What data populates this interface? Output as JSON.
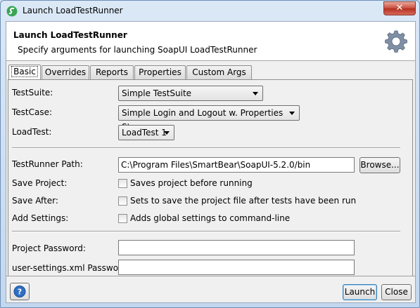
{
  "window": {
    "title": "Launch LoadTestRunner",
    "close_label": "✕"
  },
  "header": {
    "title": "Launch LoadTestRunner",
    "subtitle": "Specify arguments for launching SoapUI LoadTestRunner",
    "icon": "gear-icon"
  },
  "tabs": [
    "Basic",
    "Overrides",
    "Reports",
    "Properties",
    "Custom Args"
  ],
  "basic": {
    "testsuite_label": "TestSuite:",
    "testsuite_value": "Simple TestSuite",
    "testcase_label": "TestCase:",
    "testcase_value": "Simple Login and Logout w. Properties Steps",
    "loadtest_label": "LoadTest:",
    "loadtest_value": "LoadTest 1",
    "runner_path_label": "TestRunner Path:",
    "runner_path_value": "C:\\Program Files\\SmartBear\\SoapUI-5.2.0/bin",
    "browse_label": "Browse...",
    "save_project_label": "Save Project:",
    "save_project_text": "Saves project before running",
    "save_after_label": "Save After:",
    "save_after_text": "Sets to save the project file after tests have been run",
    "add_settings_label": "Add Settings:",
    "add_settings_text": "Adds global settings to command-line",
    "project_password_label": "Project Password:",
    "project_password_value": "",
    "settings_password_label": "user-settings.xml Password:",
    "settings_password_value": ""
  },
  "footer": {
    "help_icon": "help-icon",
    "launch_label": "Launch",
    "close_label": "Close"
  }
}
